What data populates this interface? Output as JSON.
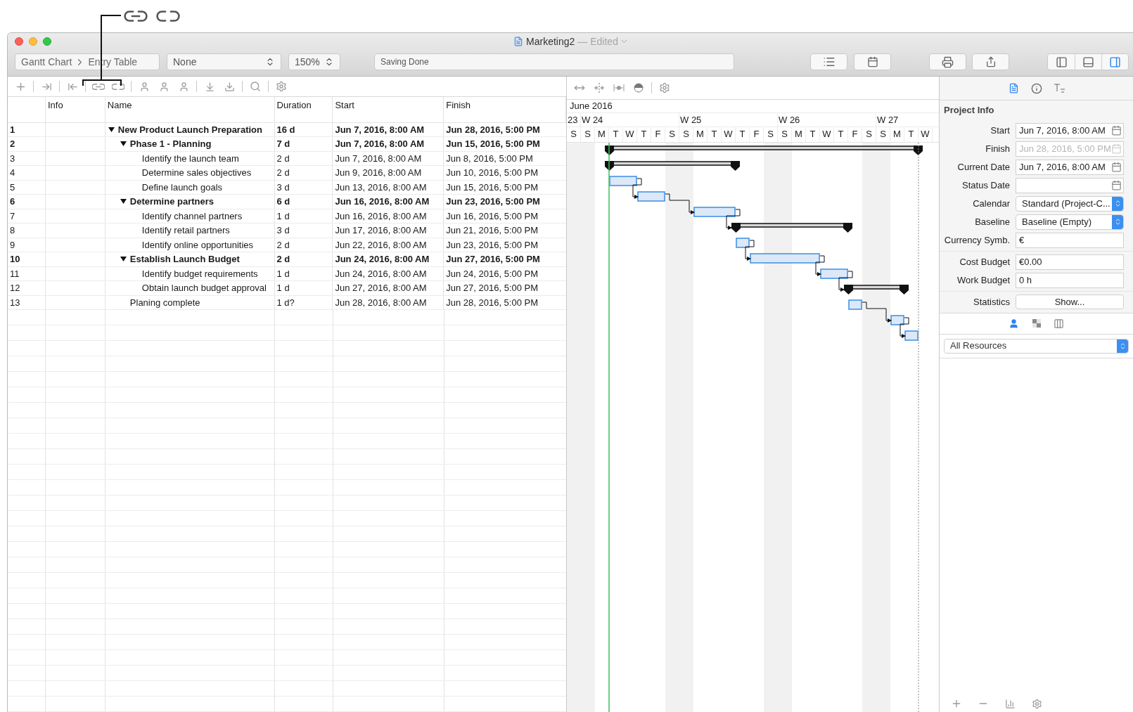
{
  "window": {
    "title": "Marketing2",
    "subtitle": "— Edited"
  },
  "toolbar": {
    "breadcrumb": [
      "Gantt Chart",
      "Entry Table"
    ],
    "filter": "None",
    "zoom": "150%",
    "status": "Saving Done",
    "view_buttons": [
      {
        "selected": false
      },
      {
        "selected": false
      },
      {
        "selected": true
      }
    ]
  },
  "table": {
    "columns": [
      "Info",
      "Name",
      "Duration",
      "Start",
      "Finish"
    ],
    "rows": [
      {
        "number": "1",
        "name": "New Product Launch Preparation",
        "duration": "16 d",
        "start": "Jun 7, 2016, 8:00 AM",
        "finish": "Jun 28, 2016, 5:00 PM",
        "kind": "summary",
        "expanded": true,
        "children": [
          {
            "number": "2",
            "name": "Phase 1 - Planning",
            "duration": "7 d",
            "start": "Jun 7, 2016, 8:00 AM",
            "finish": "Jun 15, 2016, 5:00 PM",
            "kind": "summary",
            "expanded": true,
            "children": [
              {
                "number": "3",
                "name": "Identify the launch team",
                "duration": "2 d",
                "start": "Jun 7, 2016, 8:00 AM",
                "finish": "Jun 8, 2016, 5:00 PM",
                "kind": "task"
              },
              {
                "number": "4",
                "name": "Determine sales objectives",
                "duration": "2 d",
                "start": "Jun 9, 2016, 8:00 AM",
                "finish": "Jun 10, 2016, 5:00 PM",
                "kind": "task"
              },
              {
                "number": "5",
                "name": "Define launch goals",
                "duration": "3 d",
                "start": "Jun 13, 2016, 8:00 AM",
                "finish": "Jun 15, 2016, 5:00 PM",
                "kind": "task"
              }
            ]
          },
          {
            "number": "6",
            "name": "Determine partners",
            "duration": "6 d",
            "start": "Jun 16, 2016, 8:00 AM",
            "finish": "Jun 23, 2016, 5:00 PM",
            "kind": "summary",
            "expanded": true,
            "children": [
              {
                "number": "7",
                "name": "Identify channel partners",
                "duration": "1 d",
                "start": "Jun 16, 2016, 8:00 AM",
                "finish": "Jun 16, 2016, 5:00 PM",
                "kind": "task"
              },
              {
                "number": "8",
                "name": "Identify retail partners",
                "duration": "3 d",
                "start": "Jun 17, 2016, 8:00 AM",
                "finish": "Jun 21, 2016, 5:00 PM",
                "kind": "task"
              },
              {
                "number": "9",
                "name": "Identify online opportunities",
                "duration": "2 d",
                "start": "Jun 22, 2016, 8:00 AM",
                "finish": "Jun 23, 2016, 5:00 PM",
                "kind": "task"
              }
            ]
          },
          {
            "number": "10",
            "name": "Establish Launch Budget",
            "duration": "2 d",
            "start": "Jun 24, 2016, 8:00 AM",
            "finish": "Jun 27, 2016, 5:00 PM",
            "kind": "summary",
            "expanded": true,
            "children": [
              {
                "number": "11",
                "name": "Identify budget requirements",
                "duration": "1 d",
                "start": "Jun 24, 2016, 8:00 AM",
                "finish": "Jun 24, 2016, 5:00 PM",
                "kind": "task"
              },
              {
                "number": "12",
                "name": "Obtain launch budget approval",
                "duration": "1 d",
                "start": "Jun 27, 2016, 8:00 AM",
                "finish": "Jun 27, 2016, 5:00 PM",
                "kind": "task"
              }
            ]
          },
          {
            "number": "13",
            "name": "Planing complete",
            "duration": "1 d?",
            "start": "Jun 28, 2016, 8:00 AM",
            "finish": "Jun 28, 2016, 5:00 PM",
            "kind": "task"
          }
        ]
      }
    ]
  },
  "gantt": {
    "month": "June 2016",
    "weeks": [
      "23",
      "W 24",
      "W 25",
      "W 26",
      "W 27"
    ],
    "days": [
      "S",
      "S",
      "M",
      "T",
      "W",
      "T",
      "F",
      "S",
      "S",
      "M",
      "T",
      "W",
      "T",
      "F",
      "S",
      "S",
      "M",
      "T",
      "W",
      "T",
      "F",
      "S",
      "S",
      "M",
      "T",
      "W"
    ]
  },
  "inspector": {
    "tabs": [
      {
        "selected": true
      },
      {
        "selected": false
      },
      {
        "selected": false
      }
    ],
    "title": "Project Info",
    "sections": [
      [
        {
          "label": "Start",
          "kind": "date",
          "value": "Jun 7, 2016, 8:00 AM",
          "disabled": false
        },
        {
          "label": "Finish",
          "kind": "date",
          "value": "Jun 28, 2016, 5:00 PM",
          "disabled": true
        },
        {
          "label": "Current Date",
          "kind": "date",
          "value": "Jun 7, 2016, 8:00 AM",
          "disabled": false
        },
        {
          "label": "Status Date",
          "kind": "date",
          "disabled": false
        },
        {
          "label": "Calendar",
          "kind": "select",
          "value": "Standard (Project-C...",
          "disabled": false
        },
        {
          "label": "Baseline",
          "kind": "select",
          "value": "Baseline (Empty)",
          "disabled": false
        },
        {
          "label": "Currency Symb.",
          "kind": "text",
          "value": "€",
          "disabled": false
        }
      ],
      [
        {
          "label": "Cost Budget",
          "kind": "text",
          "value": "€0.00",
          "disabled": false
        },
        {
          "label": "Work Budget",
          "kind": "text",
          "value": "0 h",
          "disabled": false
        }
      ],
      [
        {
          "label": "Statistics",
          "kind": "button",
          "value": "Show...",
          "disabled": false
        }
      ]
    ]
  },
  "resources": {
    "tabs": [
      {
        "selected": true
      },
      {
        "selected": false
      },
      {
        "selected": false
      }
    ],
    "filter": "All Resources"
  }
}
